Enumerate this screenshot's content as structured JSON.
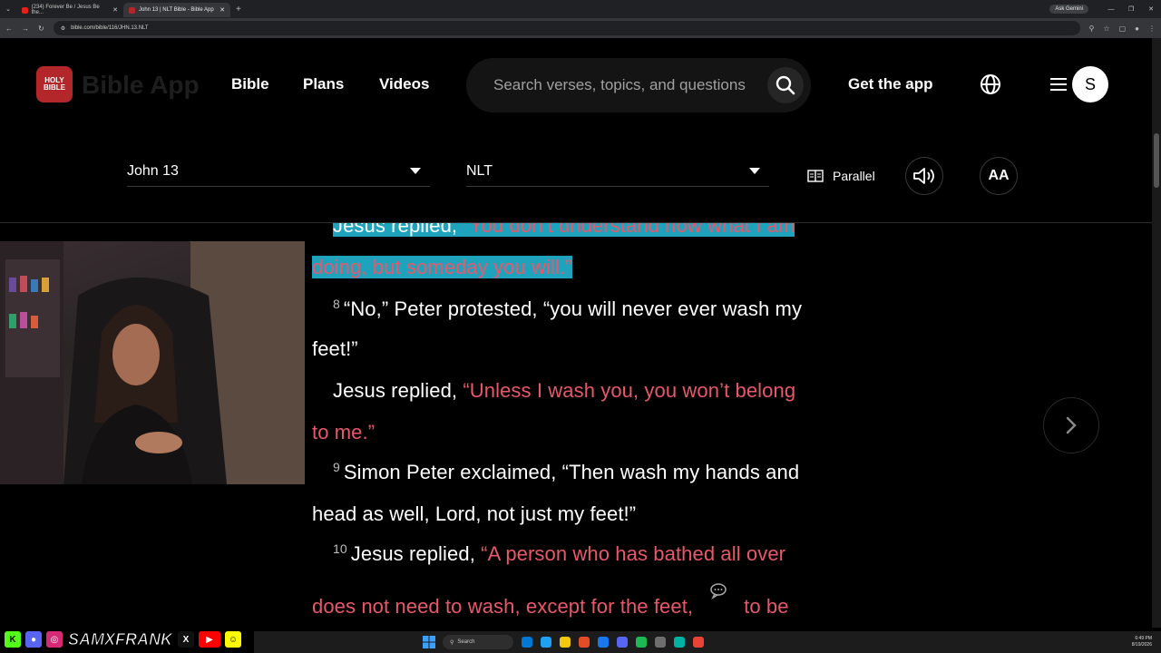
{
  "browser": {
    "tabs": [
      {
        "title": "(234) Forever Be / Jesus Be the...",
        "favicon_color": "#e62117",
        "active": false
      },
      {
        "title": "John 13 | NLT Bible - Bible App",
        "favicon_color": "#b3262a",
        "active": true
      }
    ],
    "new_tab": "+",
    "ask_gemini": "Ask Gemini",
    "url": "bible.com/bible/116/JHN.13.NLT"
  },
  "site": {
    "logo_line1": "HOLY",
    "logo_line2": "BIBLE",
    "logo_text": "Bible App",
    "nav": [
      "Bible",
      "Plans",
      "Videos"
    ],
    "search_placeholder": "Search verses, topics, and questions",
    "get_app": "Get the app",
    "avatar_initial": "S"
  },
  "toolbar": {
    "chapter": "John 13",
    "version": "NLT",
    "parallel_label": "Parallel",
    "text_size_label": "AA"
  },
  "reader": {
    "lines": [
      {
        "segments": [
          {
            "t": "Jesus replied, ",
            "c": "plain",
            "hl": true
          },
          {
            "t": "“You don’t understand now what I am",
            "c": "red",
            "hl": true
          }
        ]
      },
      {
        "segments": [
          {
            "t": "doing, but someday you will.”",
            "c": "red",
            "hl": true
          }
        ]
      },
      {
        "verse": "8",
        "segments": [
          {
            "t": "“No,” Peter protested, “you will never ever wash my",
            "c": "plain"
          }
        ]
      },
      {
        "segments": [
          {
            "t": "feet!”",
            "c": "plain"
          }
        ]
      },
      {
        "segments": [
          {
            "t": "Jesus replied, ",
            "c": "plain"
          },
          {
            "t": "“Unless I wash you, you won’t belong",
            "c": "red"
          }
        ]
      },
      {
        "segments": [
          {
            "t": "to me.”",
            "c": "red"
          }
        ]
      },
      {
        "verse": "9",
        "segments": [
          {
            "t": "Simon Peter exclaimed, “Then wash my hands and",
            "c": "plain"
          }
        ]
      },
      {
        "segments": [
          {
            "t": "head as well, Lord, not just my feet!”",
            "c": "plain"
          }
        ]
      },
      {
        "verse": "10",
        "segments": [
          {
            "t": "Jesus replied, ",
            "c": "plain"
          },
          {
            "t": "“A person who has bathed all over",
            "c": "red"
          }
        ]
      },
      {
        "segments": [
          {
            "t": "does not need to wash, except for the feet,",
            "c": "red"
          },
          {
            "t": "note",
            "c": "note"
          },
          {
            "t": "to be",
            "c": "red"
          }
        ]
      }
    ]
  },
  "overlay": {
    "handle": "SAMXFRANK",
    "socials": [
      {
        "name": "kick-icon",
        "label": "K",
        "color": "#53fc18"
      },
      {
        "name": "discord-icon",
        "label": "●",
        "color": "#5865f2"
      },
      {
        "name": "instagram-icon",
        "label": "◎",
        "color": "#d62976"
      },
      {
        "name": "x-icon",
        "label": "X",
        "color": "#111111"
      },
      {
        "name": "youtube-icon",
        "label": "▶",
        "color": "#ff0000"
      },
      {
        "name": "snapchat-icon",
        "label": "☺",
        "color": "#fffc00"
      }
    ]
  },
  "taskbar": {
    "search_label": "Search",
    "time": "6:49 PM",
    "date": "8/19/2026",
    "icons": [
      "#0078d4",
      "#1da1f2",
      "#f2c811",
      "#e34c26",
      "#1877f2",
      "#5865f2",
      "#1db954",
      "#6e6e6e",
      "#00b3a1",
      "#ea4335"
    ]
  }
}
